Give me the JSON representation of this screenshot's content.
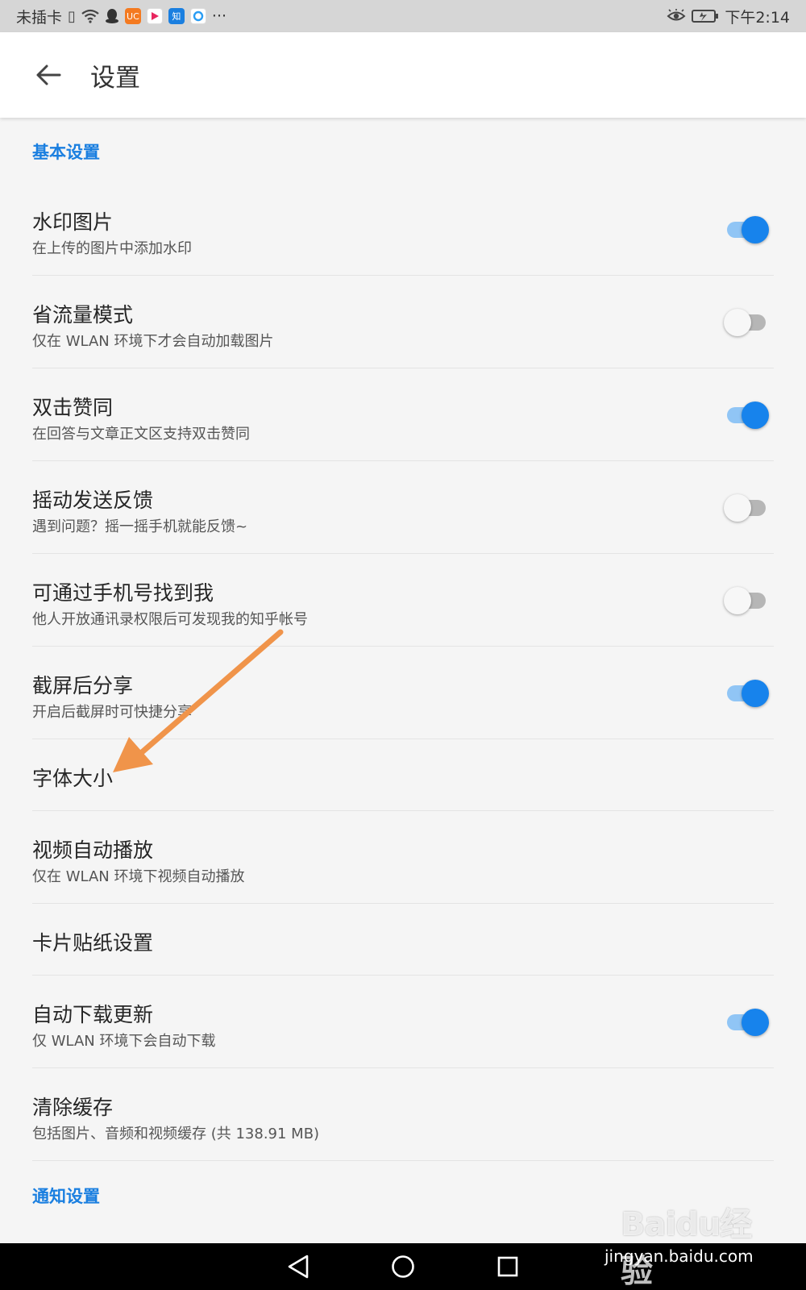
{
  "status_bar": {
    "carrier": "未插卡",
    "time": "下午2:14",
    "more": "···",
    "left_icons": [
      "sim-alert-icon",
      "wifi-icon",
      "qq-icon",
      "uc-browser-icon",
      "video-app-icon",
      "zhihu-app-icon",
      "browser-app-icon"
    ],
    "right_icons": [
      "eye-comfort-icon",
      "battery-charging-icon"
    ]
  },
  "app_bar": {
    "back_icon": "arrow-left-icon",
    "title": "设置"
  },
  "sections": {
    "basic": "基本设置",
    "notification": "通知设置"
  },
  "settings": [
    {
      "title": "水印图片",
      "subtitle": "在上传的图片中添加水印",
      "toggle": true
    },
    {
      "title": "省流量模式",
      "subtitle": "仅在 WLAN 环境下才会自动加载图片",
      "toggle": false
    },
    {
      "title": "双击赞同",
      "subtitle": "在回答与文章正文区支持双击赞同",
      "toggle": true
    },
    {
      "title": "摇动发送反馈",
      "subtitle": "遇到问题？摇一摇手机就能反馈~",
      "toggle": false
    },
    {
      "title": "可通过手机号找到我",
      "subtitle": "他人开放通讯录权限后可发现我的知乎帐号",
      "toggle": false
    },
    {
      "title": "截屏后分享",
      "subtitle": "开启后截屏时可快捷分享",
      "toggle": true
    },
    {
      "title": "字体大小"
    },
    {
      "title": "视频自动播放",
      "subtitle": "仅在 WLAN 环境下视频自动播放"
    },
    {
      "title": "卡片贴纸设置"
    },
    {
      "title": "自动下载更新",
      "subtitle": "仅 WLAN 环境下会自动下载",
      "toggle": true
    },
    {
      "title": "清除缓存",
      "subtitle": "包括图片、音频和视频缓存 (共 138.91 MB)"
    }
  ],
  "colors": {
    "accent": "#1783ec",
    "section_header": "#1a7fe0",
    "annotation_arrow": "#f0944a"
  },
  "nav_bar": {
    "icons": [
      "back-triangle-icon",
      "home-circle-icon",
      "recents-square-icon"
    ]
  },
  "watermark": {
    "logo": "Baidu经验",
    "url": "jingyan.baidu.com"
  }
}
